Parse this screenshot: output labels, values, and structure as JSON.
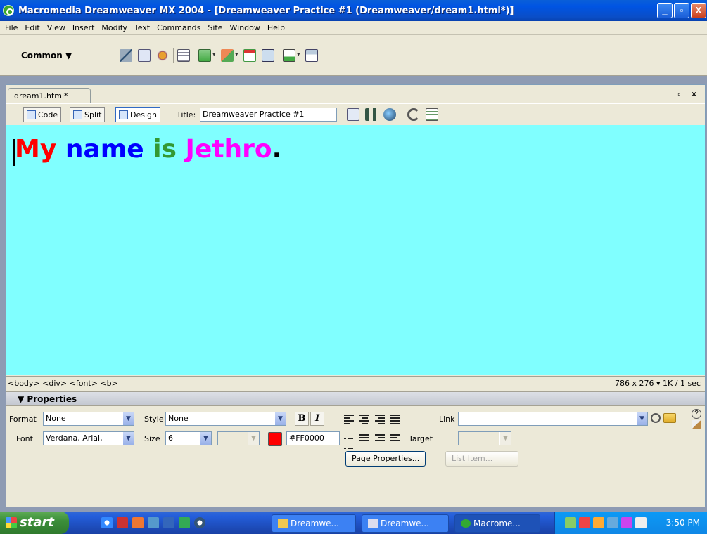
{
  "window": {
    "title": "Macromedia Dreamweaver MX 2004 - [Dreamweaver Practice #1 (Dreamweaver/dream1.html*)]",
    "min": "_",
    "max": "▫",
    "close": "X"
  },
  "menu": [
    "File",
    "Edit",
    "View",
    "Insert",
    "Modify",
    "Text",
    "Commands",
    "Site",
    "Window",
    "Help"
  ],
  "insertbar": {
    "category": "Common ▼"
  },
  "document": {
    "tab": "dream1.html*",
    "controls": "_ ▫ ×",
    "views": {
      "code": "Code",
      "split": "Split",
      "design": "Design"
    },
    "title_label": "Title:",
    "title_value": "Dreamweaver Practice #1",
    "heading": [
      {
        "text": "My",
        "color": "#ff0000"
      },
      {
        "text": " name",
        "color": "#0000ff"
      },
      {
        "text": " is",
        "color": "#339933"
      },
      {
        "text": " Jethro",
        "color": "#ff00ff"
      },
      {
        "text": ".",
        "color": "#000000"
      }
    ],
    "canvas_color": "#80ffff",
    "tag_selector": "<body> <div> <font> <b>",
    "size_info": "786 x 276 ▾ 1K / 1 sec"
  },
  "properties": {
    "header": "▼ Properties",
    "format_label": "Format",
    "format_value": "None",
    "style_label": "Style",
    "style_value": "None",
    "bold": "B",
    "italic": "I",
    "link_label": "Link",
    "link_value": "",
    "font_label": "Font",
    "font_value": "Verdana, Arial,",
    "size_label": "Size",
    "size_value": "6",
    "color_hex": "#FF0000",
    "swatch_color": "#ff0000",
    "target_label": "Target",
    "page_properties": "Page Properties...",
    "list_item": "List Item..."
  },
  "taskbar": {
    "start": "start",
    "tasks": [
      "Dreamwe...",
      "Dreamwe...",
      "Macrome..."
    ],
    "clock": "3:50 PM"
  }
}
